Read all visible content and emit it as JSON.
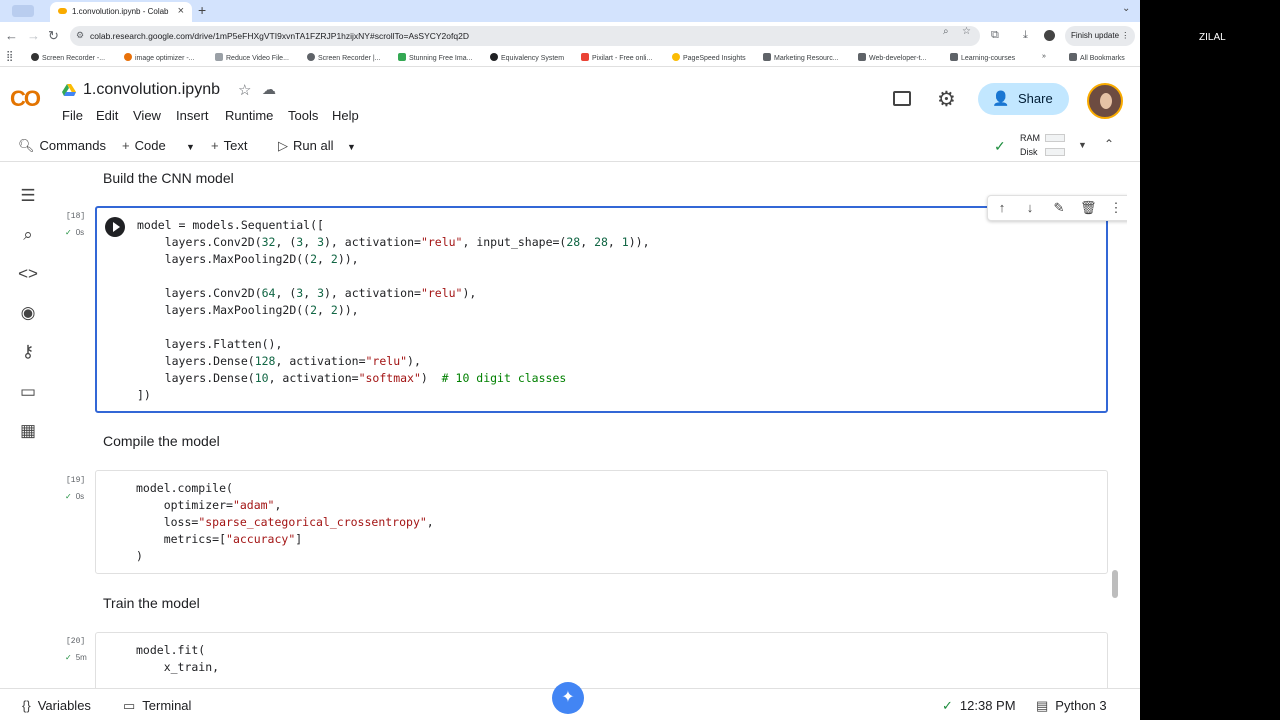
{
  "browser": {
    "tab_title": "1.convolution.ipynb - Colab",
    "url": "colab.research.google.com/drive/1mP5eFHXgVTI9xvnTA1FZRJP1hzijxNY#scrollTo=AsSYCY2ofq2D",
    "finish_update_label": "Finish update",
    "bookmarks": [
      "Screen Recorder -...",
      "image optimizer -...",
      "Reduce Video File...",
      "Screen Recorder |...",
      "Stunning Free Ima...",
      "Equivalency System",
      "Pixilart - Free onli...",
      "PageSpeed Insights",
      "Marketing Resourc...",
      "Web-developer-t...",
      "Learning-courses"
    ],
    "all_bookmarks_label": "All Bookmarks"
  },
  "right_label": "ZILAL",
  "colab": {
    "logo": "CO",
    "notebook_title": "1.convolution.ipynb",
    "menu": [
      "File",
      "Edit",
      "View",
      "Insert",
      "Runtime",
      "Tools",
      "Help"
    ],
    "share_label": "Share",
    "commands_label": "Commands",
    "code_label": "Code",
    "text_label": "Text",
    "run_all_label": "Run all",
    "ram_label": "RAM",
    "disk_label": "Disk"
  },
  "cells": {
    "heading_build": "Build the CNN model",
    "cell18": {
      "count": "[18]",
      "time": "0s",
      "lines": [
        "model = models.Sequential([",
        "    layers.Conv2D(32, (3, 3), activation=\"relu\", input_shape=(28, 28, 1)),",
        "    layers.MaxPooling2D((2, 2)),",
        "",
        "    layers.Conv2D(64, (3, 3), activation=\"relu\"),",
        "    layers.MaxPooling2D((2, 2)),",
        "",
        "    layers.Flatten(),",
        "    layers.Dense(128, activation=\"relu\"),",
        "    layers.Dense(10, activation=\"softmax\")  # 10 digit classes",
        "])"
      ]
    },
    "heading_compile": "Compile the model",
    "cell19": {
      "count": "[19]",
      "time": "0s",
      "lines": [
        "model.compile(",
        "    optimizer=\"adam\",",
        "    loss=\"sparse_categorical_crossentropy\",",
        "    metrics=[\"accuracy\"]",
        ")"
      ]
    },
    "heading_train": "Train the model",
    "cell20": {
      "count": "[20]",
      "time": "5m",
      "lines": [
        "model.fit(",
        "    x_train,"
      ]
    }
  },
  "status": {
    "variables_label": "Variables",
    "terminal_label": "Terminal",
    "time": "12:38 PM",
    "runtime": "Python 3"
  }
}
